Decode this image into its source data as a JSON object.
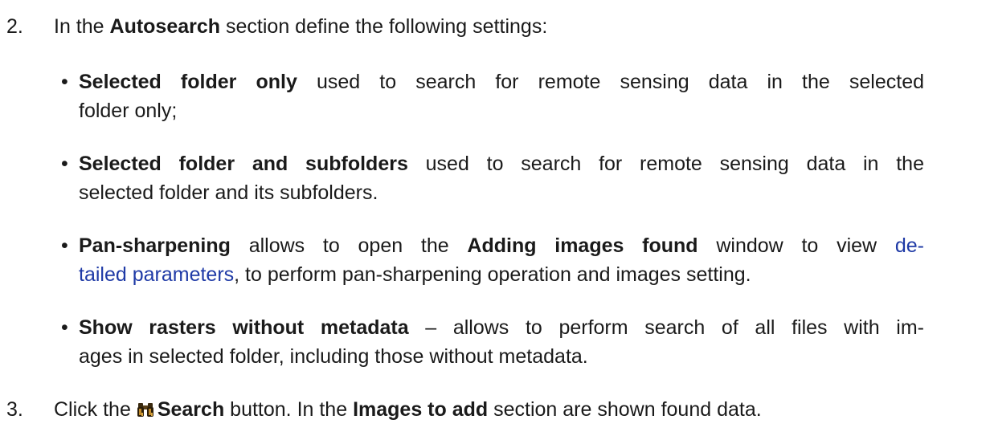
{
  "step2": {
    "number": "2.",
    "intro_pre": "In the",
    "intro_bold": "Autosearch",
    "intro_post": "section define the following settings:"
  },
  "bullets": [
    {
      "dot": "•",
      "bold": "Selected folder only",
      "line1_rest": "used to search for remote sensing data in the selected",
      "line2": "folder only;"
    },
    {
      "dot": "•",
      "bold": "Selected folder and subfolders",
      "line1_rest": "used to search for remote sensing data in the",
      "line2": "selected folder and its subfolders."
    },
    {
      "dot": "•",
      "bold": "Pan-sharpening",
      "line1_mid": "allows to open the",
      "bold2": "Adding images found",
      "line1_rest": "window to view",
      "link_part1": "de-",
      "link_part2": "tailed parameters",
      "line2_rest": ", to perform pan-sharpening operation and images setting."
    },
    {
      "dot": "•",
      "bold": "Show rasters without metadata",
      "line1_rest": "– allows to perform search of all files with im-",
      "line2": "ages in selected folder, including those without metadata."
    }
  ],
  "step3": {
    "number": "3.",
    "pre": "Click the",
    "icon": "binoculars-icon",
    "bold": "Search",
    "mid": "button. In the",
    "bold2": "Images to add",
    "post": "section are shown found data."
  },
  "colors": {
    "link": "#1f3aa6",
    "text": "#1a1a1a"
  }
}
